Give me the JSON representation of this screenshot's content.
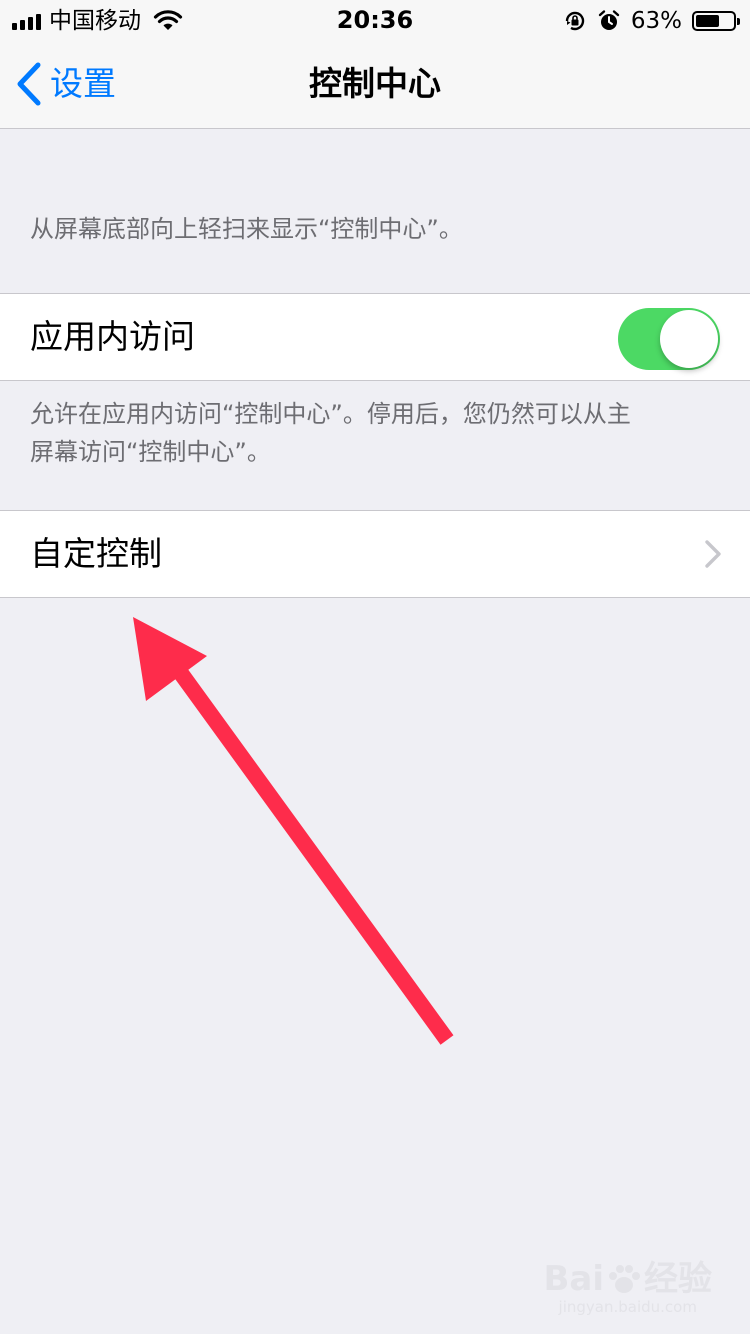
{
  "status_bar": {
    "carrier": "中国移动",
    "time": "20:36",
    "battery_percent": "63%",
    "battery_level": 0.63,
    "icons": [
      "signal-icon",
      "wifi-icon",
      "rotation-lock-icon",
      "alarm-icon",
      "battery-icon"
    ]
  },
  "nav": {
    "back_label": "设置",
    "title": "控制中心"
  },
  "content": {
    "intro_text": "从屏幕底部向上轻扫来显示“控制中心”。",
    "in_app_access": {
      "label": "应用内访问",
      "enabled": true
    },
    "in_app_footer_line1": "允许在应用内访问“控制中心”。停用后，您仍然可以从主",
    "in_app_footer_line2": "屏幕访问“控制中心”。",
    "customize_label": "自定控制"
  },
  "annotation": {
    "arrow_color": "#fe2c4b"
  },
  "watermark": {
    "brand": "Bai",
    "brand_suffix": "经验",
    "url": "jingyan.baidu.com"
  },
  "colors": {
    "accent": "#007aff",
    "toggle_on": "#4cd964",
    "background": "#efeff4"
  }
}
